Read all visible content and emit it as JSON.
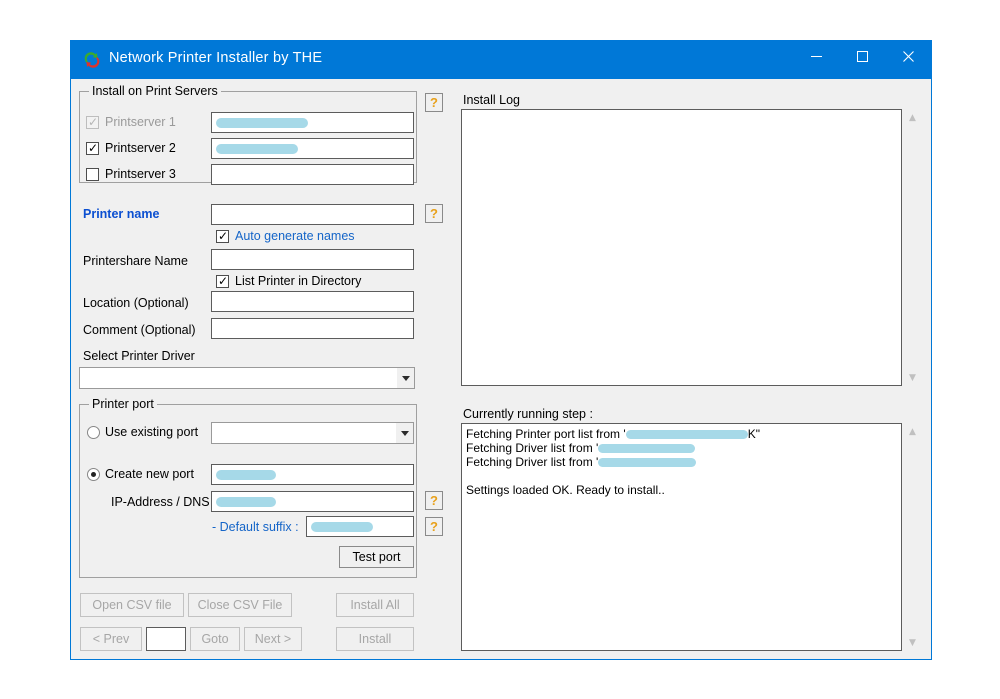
{
  "window": {
    "title": "Network Printer Installer by THE",
    "icon": "sync-arrows-icon",
    "accent_color": "#0078d7",
    "face_color": "#f0f0f0",
    "redaction_color": "#a6d9e8",
    "controls": {
      "minimize": "minimize-button",
      "maximize": "maximize-button",
      "close": "close-button"
    }
  },
  "print_servers": {
    "group_title": "Install on Print Servers",
    "help_label": "?",
    "rows": [
      {
        "label": "Printserver 1",
        "checked": true,
        "disabled": true,
        "value": "",
        "redacted": true
      },
      {
        "label": "Printserver 2",
        "checked": true,
        "disabled": false,
        "value": "",
        "redacted": true
      },
      {
        "label": "Printserver 3",
        "checked": false,
        "disabled": false,
        "value": "",
        "redacted": false
      }
    ]
  },
  "printer_details": {
    "printer_name_label": "Printer name",
    "printer_name_value": "",
    "printer_name_help": "?",
    "auto_generate_label": "Auto generate names",
    "auto_generate_checked": true,
    "printershare_label": "Printershare Name",
    "printershare_value": "",
    "list_in_directory_label": "List Printer in Directory",
    "list_in_directory_checked": true,
    "location_label": "Location (Optional)",
    "location_value": "",
    "comment_label": "Comment (Optional)",
    "comment_value": "",
    "driver_label": "Select Printer Driver",
    "driver_value": ""
  },
  "printer_port": {
    "group_title": "Printer port",
    "use_existing_label": "Use existing port",
    "use_existing_selected": false,
    "use_existing_value": "",
    "create_new_label": "Create new port",
    "create_new_selected": true,
    "create_new_value": "",
    "ip_dns_label": "IP-Address / DNS",
    "ip_dns_value": "",
    "ip_dns_help": "?",
    "suffix_label": "- Default suffix :",
    "suffix_value": "",
    "suffix_help": "?",
    "test_port_label": "Test port"
  },
  "bottom_buttons": {
    "open_csv": "Open CSV file",
    "close_csv": "Close CSV File",
    "install_all": "Install All",
    "prev": "< Prev",
    "goto_value": "",
    "goto": "Goto",
    "next": "Next >",
    "install": "Install"
  },
  "install_log": {
    "title": "Install Log",
    "lines": []
  },
  "current_step": {
    "title": "Currently running step :",
    "lines": [
      {
        "prefix": "Fetching Printer port list from '",
        "redacted": true,
        "suffix": "K\""
      },
      {
        "prefix": "Fetching Driver list from '",
        "redacted": true,
        "suffix": ""
      },
      {
        "prefix": "Fetching Driver list from '",
        "redacted": true,
        "suffix": ""
      },
      {
        "prefix": "",
        "redacted": false,
        "suffix": ""
      },
      {
        "prefix": "Settings loaded OK. Ready to install..",
        "redacted": false,
        "suffix": ""
      }
    ]
  }
}
